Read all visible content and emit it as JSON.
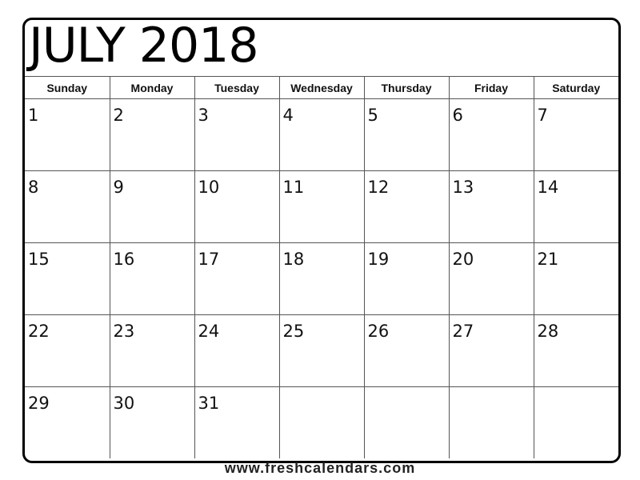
{
  "title": "JULY 2018",
  "weekdays": [
    "Sunday",
    "Monday",
    "Tuesday",
    "Wednesday",
    "Thursday",
    "Friday",
    "Saturday"
  ],
  "weeks": [
    [
      "1",
      "2",
      "3",
      "4",
      "5",
      "6",
      "7"
    ],
    [
      "8",
      "9",
      "10",
      "11",
      "12",
      "13",
      "14"
    ],
    [
      "15",
      "16",
      "17",
      "18",
      "19",
      "20",
      "21"
    ],
    [
      "22",
      "23",
      "24",
      "25",
      "26",
      "27",
      "28"
    ],
    [
      "29",
      "30",
      "31",
      "",
      "",
      "",
      ""
    ]
  ],
  "footer": "www.freshcalendars.com"
}
